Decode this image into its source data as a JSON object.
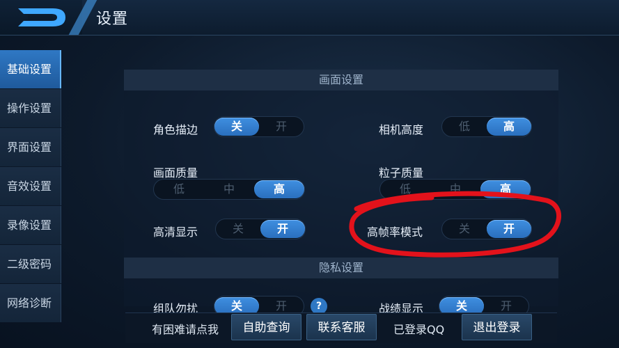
{
  "header": {
    "title": "设置"
  },
  "sidebar": {
    "items": [
      {
        "label": "基础设置",
        "active": true
      },
      {
        "label": "操作设置"
      },
      {
        "label": "界面设置"
      },
      {
        "label": "音效设置"
      },
      {
        "label": "录像设置"
      },
      {
        "label": "二级密码"
      },
      {
        "label": "网络诊断"
      }
    ]
  },
  "display_section": {
    "title": "画面设置",
    "settings": {
      "outline": {
        "label": "角色描边",
        "options": [
          "关",
          "开"
        ],
        "selected": "关"
      },
      "camera": {
        "label": "相机高度",
        "options": [
          "低",
          "高"
        ],
        "selected": "高"
      },
      "quality": {
        "label": "画面质量",
        "options": [
          "低",
          "中",
          "高"
        ],
        "selected": "高"
      },
      "particle": {
        "label": "粒子质量",
        "options": [
          "低",
          "中",
          "高"
        ],
        "selected": "高"
      },
      "hd": {
        "label": "高清显示",
        "options": [
          "关",
          "开"
        ],
        "selected": "开"
      },
      "hfr": {
        "label": "高帧率模式",
        "options": [
          "关",
          "开"
        ],
        "selected": "开"
      }
    }
  },
  "privacy_section": {
    "title": "隐私设置",
    "settings": {
      "team": {
        "label": "组队勿扰",
        "options": [
          "关",
          "开"
        ],
        "selected": "关",
        "help": "?"
      },
      "record": {
        "label": "战绩显示",
        "options": [
          "关",
          "开"
        ],
        "selected": "关"
      }
    }
  },
  "bottom_bar": {
    "help_text": "有困难请点我",
    "self_help": "自助查询",
    "contact": "联系客服",
    "login_status": "已登录QQ",
    "logout": "退出登录"
  },
  "colors": {
    "accent": "#3f8fe0",
    "annotation": "#e3121b"
  }
}
